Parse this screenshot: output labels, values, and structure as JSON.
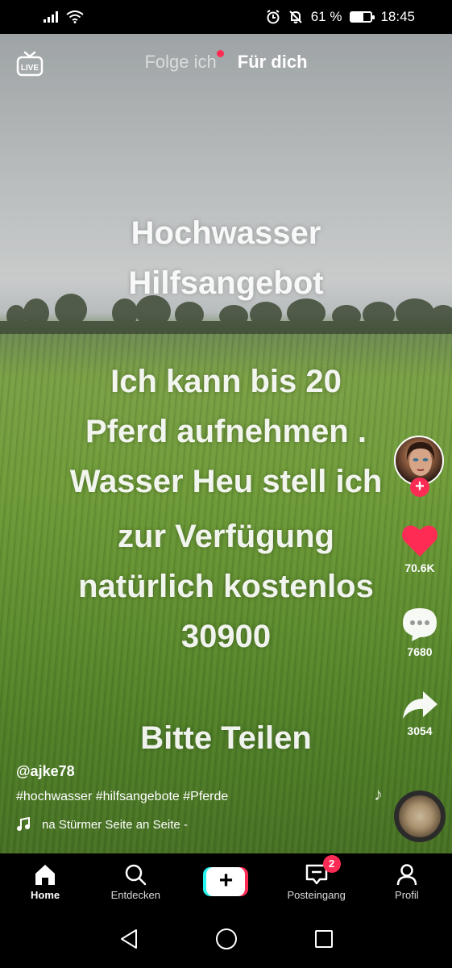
{
  "status_bar": {
    "battery_percent": "61 %",
    "battery_level": 0.61,
    "time": "18:45"
  },
  "top_nav": {
    "live_label": "LIVE",
    "tabs": [
      {
        "label": "Folge ich",
        "active": false,
        "has_dot": true
      },
      {
        "label": "Für dich",
        "active": true
      }
    ]
  },
  "video_text": {
    "line1": "Hochwasser",
    "line2": "Hilfsangebot",
    "line3": "Ich kann bis 20",
    "line4": "Pferd aufnehmen .",
    "line5": "Wasser Heu stell ich",
    "line6": "zur Verfügung",
    "line7": "natürlich kostenlos",
    "line8": "30900",
    "line9": "Bitte Teilen"
  },
  "rail": {
    "like_count": "70.6K",
    "comment_count": "7680",
    "share_count": "3054",
    "follow_plus": "+"
  },
  "caption": {
    "username": "@ajke78",
    "hashtags": "#hochwasser #hilfsangebote #Pferde",
    "music": "na Stürmer    Seite an Seite - "
  },
  "bottom_nav": {
    "home": "Home",
    "discover": "Entdecken",
    "create": "+",
    "inbox": "Posteingang",
    "inbox_badge": "2",
    "profile": "Profil"
  },
  "colors": {
    "accent_red": "#fe2c55",
    "accent_cyan": "#25f4ee"
  }
}
